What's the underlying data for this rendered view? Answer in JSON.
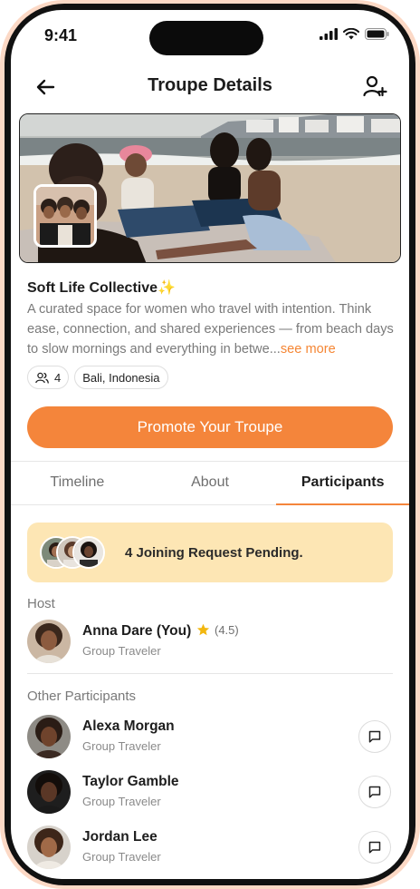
{
  "status_bar": {
    "time": "9:41"
  },
  "header": {
    "title": "Troupe Details",
    "back_icon": "arrow-left-icon",
    "add_icon": "user-plus-icon"
  },
  "troupe": {
    "name": "Soft Life Collective",
    "name_emoji": "✨",
    "description": "A curated space for women who travel with intention. Think ease, connection, and shared experiences — from beach days to slow mornings and everything in betwe...",
    "see_more": "see more",
    "member_count": "4",
    "location": "Bali, Indonesia"
  },
  "promote_button": "Promote Your Troupe",
  "tabs": [
    {
      "label": "Timeline"
    },
    {
      "label": "About"
    },
    {
      "label": "Participants"
    }
  ],
  "active_tab": "Participants",
  "request_banner": {
    "text": "4 Joining Request Pending."
  },
  "host_section": {
    "label": "Host",
    "host": {
      "name": "Anna Dare (You)",
      "rating": "(4.5)",
      "role": "Group Traveler"
    }
  },
  "participants_section": {
    "label": "Other Participants",
    "items": [
      {
        "name": "Alexa Morgan",
        "role": "Group Traveler"
      },
      {
        "name": "Taylor Gamble",
        "role": "Group Traveler"
      },
      {
        "name": "Jordan Lee",
        "role": "Group Traveler"
      }
    ]
  },
  "colors": {
    "accent": "#f4853b",
    "banner_bg": "#fde6b4",
    "star": "#f2b70f",
    "phone_rim": "#fcd9c6"
  }
}
